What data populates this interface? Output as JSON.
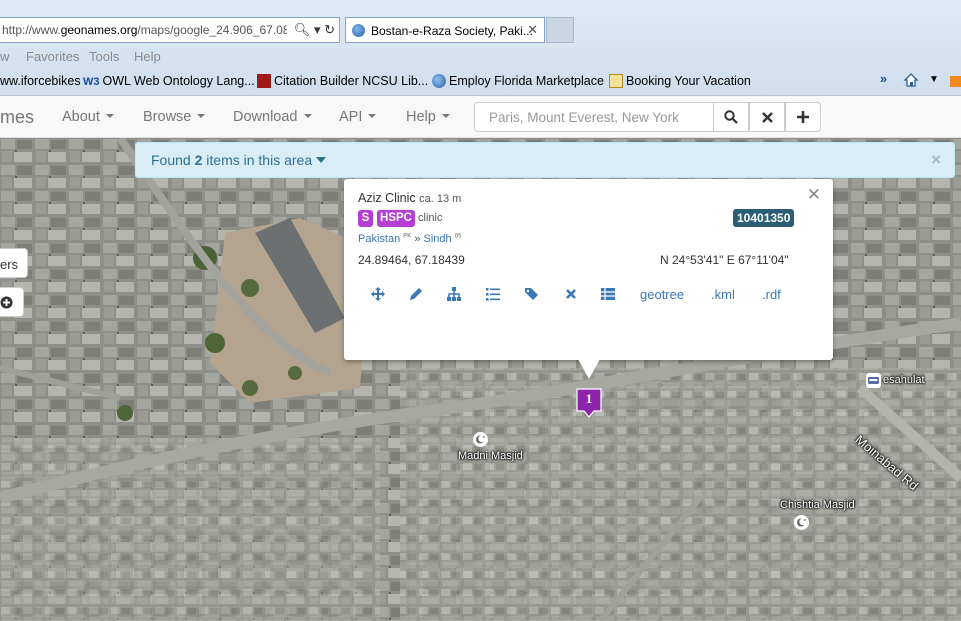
{
  "browser": {
    "address_prefix": "http://www.",
    "address_domain": "geonames.org",
    "address_rest": "/maps/google_24.906_67.08",
    "tab_title": "Bostan-e-Raza Society, Paki...",
    "menu": [
      "w",
      "Favorites",
      "Tools",
      "Help"
    ],
    "favorites": [
      {
        "label": "ww.iforcebikes",
        "icon": "none"
      },
      {
        "label": "OWL Web Ontology Lang...",
        "icon": "w3c-icon",
        "prefix": "W3"
      },
      {
        "label": "Citation Builder  NCSU Lib...",
        "icon": "citation-icon"
      },
      {
        "label": "Employ Florida Marketplace",
        "icon": "globe-icon"
      },
      {
        "label": "Booking Your Vacation",
        "icon": "page-icon"
      }
    ],
    "overflow": "»"
  },
  "navbar": {
    "brand": "mes",
    "items": [
      "About",
      "Browse",
      "Download",
      "API",
      "Help"
    ],
    "search_placeholder": "Paris, Mount Everest, New York"
  },
  "alert": {
    "prefix": "Found ",
    "count": "2",
    "suffix": " items in this area"
  },
  "map_controls": {
    "layers_label": "ers"
  },
  "popup": {
    "name": "Aziz Clinic",
    "elevation": "ca. 13 m",
    "class_badge": "S",
    "code_badge": "HSPC",
    "type": "clinic",
    "id": "10401350",
    "country": "Pakistan",
    "country_code": "PK",
    "separator": "»",
    "admin1": "Sindh",
    "admin1_code": "05",
    "coords": "24.89464, 67.18439",
    "dms": "N 24°53'41\" E 67°11'04\"",
    "links": [
      "geotree",
      ".kml",
      ".rdf"
    ],
    "tool_icons": [
      "move-icon",
      "edit-icon",
      "hierarchy-icon",
      "list-icon",
      "tags-icon",
      "delete-icon",
      "table-icon"
    ]
  },
  "marker": {
    "label": "1"
  },
  "pois": {
    "madni": "Madni Masjid",
    "chishtia": "Chishtia Masjid",
    "esahulat": "esahulat",
    "road": "Moinabad Rd"
  },
  "colors": {
    "badge_purple": "#b43fd4",
    "id_badge": "#2b5e74",
    "link_blue": "#3a78b5",
    "alert_bg": "#d9edf7"
  }
}
